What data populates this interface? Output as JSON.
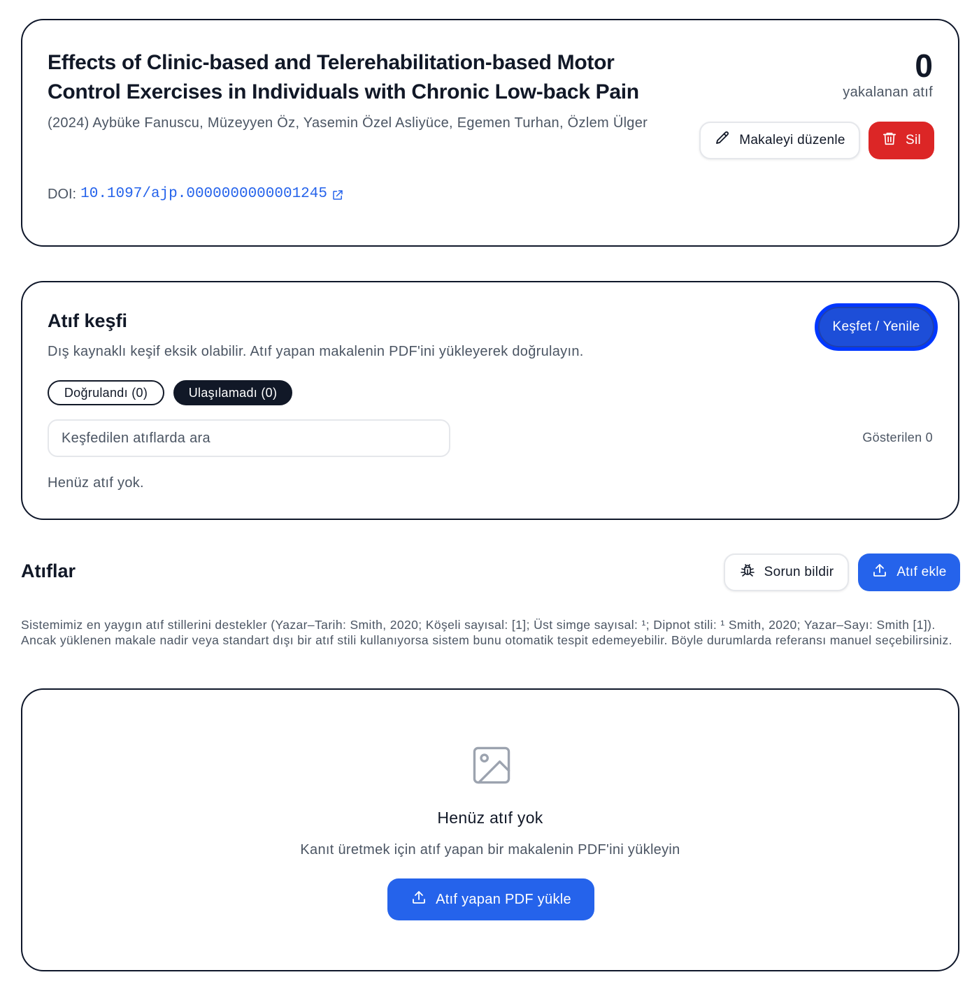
{
  "article": {
    "title": "Effects of Clinic-based and Telerehabilitation-based Motor Control Exercises in Individuals with Chronic Low-back Pain",
    "meta": "(2024) Aybüke Fanuscu, Müzeyyen Öz, Yasemin Özel Asliyüce, Egemen Turhan, Özlem Ülger",
    "doi_label": "DOI:",
    "doi_value": "10.1097/ajp.0000000000001245",
    "citation_count": "0",
    "citation_count_label": "yakalanan atıf",
    "edit_label": "Makaleyi düzenle",
    "delete_label": "Sil"
  },
  "discovery": {
    "title": "Atıf keşfi",
    "description": "Dış kaynaklı keşif eksik olabilir. Atıf yapan makalenin PDF'ini yükleyerek doğrulayın.",
    "discover_label": "Keşfet / Yenile",
    "filters": {
      "verified": "Doğrulandı (0)",
      "unreached": "Ulaşılamadı (0)"
    },
    "search_placeholder": "Keşfedilen atıflarda ara",
    "shown_count": "Gösterilen 0",
    "empty_text": "Henüz atıf yok."
  },
  "citations": {
    "title": "Atıflar",
    "report_label": "Sorun bildir",
    "add_label": "Atıf ekle",
    "note": "Sistemimiz en yaygın atıf stillerini destekler (Yazar–Tarih: Smith, 2020; Köşeli sayısal: [1]; Üst simge sayısal: ¹; Dipnot stili: ¹ Smith, 2020; Yazar–Sayı: Smith [1]). Ancak yüklenen makale nadir veya standart dışı bir atıf stili kullanıyorsa sistem bunu otomatik tespit edemeyebilir. Böyle durumlarda referansı manuel seçebilirsiniz.",
    "empty_title": "Henüz atıf yok",
    "empty_subtitle": "Kanıt üretmek için atıf yapan bir makalenin PDF'ini yükleyin",
    "upload_label": "Atıf yapan PDF yükle"
  },
  "colors": {
    "primary": "#2563eb",
    "danger": "#dc2626",
    "dark": "#111827",
    "muted": "#4b5563"
  },
  "icons": [
    "pencil-icon",
    "trash-icon",
    "external-link-icon",
    "bug-icon",
    "upload-icon",
    "image-icon"
  ]
}
